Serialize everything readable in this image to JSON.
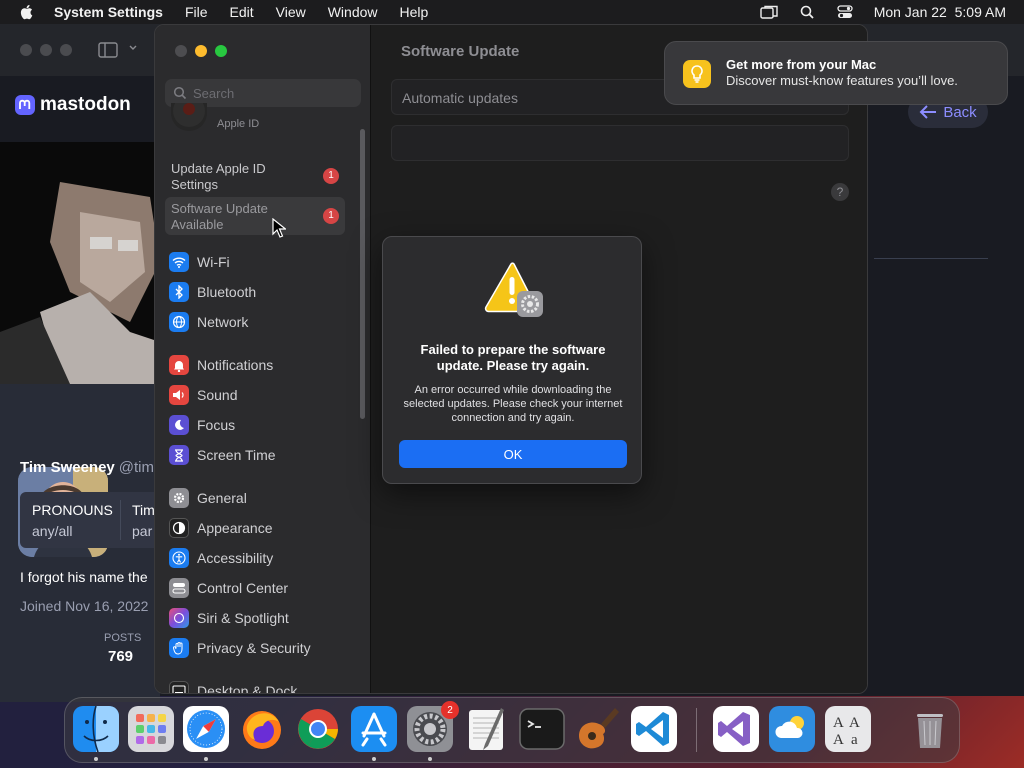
{
  "menubar": {
    "app_name": "System Settings",
    "items": [
      "File",
      "Edit",
      "View",
      "Window",
      "Help"
    ],
    "clock": "Mon Jan 22  5:09 AM"
  },
  "mastodon": {
    "logo_text": "mastodon",
    "profile": {
      "name": "Tim Sweeney",
      "handle": "@tim",
      "field1_label": "PRONOUNS",
      "field1_value": "any/all",
      "field2_label": "Tim",
      "field2_value": "par",
      "bio": "I forgot his name the",
      "joined": "Joined Nov 16, 2022",
      "posts_label": "POSTS",
      "posts_value": "769"
    },
    "back_label": "Back"
  },
  "settings": {
    "search_placeholder": "Search",
    "apple_id_label": "Apple ID",
    "notices": [
      {
        "label": "Update Apple ID Settings",
        "badge": "1"
      },
      {
        "label": "Software Update Available",
        "badge": "1"
      }
    ],
    "sidebar_groups": [
      [
        {
          "label": "Wi-Fi",
          "icon": "wifi-icon",
          "color": "#1b7cf0"
        },
        {
          "label": "Bluetooth",
          "icon": "bluetooth-icon",
          "color": "#1b7cf0"
        },
        {
          "label": "Network",
          "icon": "globe-icon",
          "color": "#1b7cf0"
        }
      ],
      [
        {
          "label": "Notifications",
          "icon": "bell-icon",
          "color": "#e5463f"
        },
        {
          "label": "Sound",
          "icon": "speaker-icon",
          "color": "#e5463f"
        },
        {
          "label": "Focus",
          "icon": "moon-icon",
          "color": "#5b4fd3"
        },
        {
          "label": "Screen Time",
          "icon": "hourglass-icon",
          "color": "#5b4fd3"
        }
      ],
      [
        {
          "label": "General",
          "icon": "gear-icon",
          "color": "#8e8e93"
        },
        {
          "label": "Appearance",
          "icon": "appearance-icon",
          "color": "#222222"
        },
        {
          "label": "Accessibility",
          "icon": "accessibility-icon",
          "color": "#1b7cf0"
        },
        {
          "label": "Control Center",
          "icon": "control-center-icon",
          "color": "#8e8e93"
        },
        {
          "label": "Siri & Spotlight",
          "icon": "siri-icon",
          "color": "#c04bd6"
        },
        {
          "label": "Privacy & Security",
          "icon": "hand-icon",
          "color": "#1b7cf0"
        }
      ],
      [
        {
          "label": "Desktop & Dock",
          "icon": "desktop-icon",
          "color": "#222222"
        }
      ]
    ],
    "content": {
      "title": "Software Update",
      "automatic_updates": "Automatic updates",
      "help": "?"
    }
  },
  "notification": {
    "title": "Get more from your Mac",
    "body": "Discover must-know features you’ll love."
  },
  "alert": {
    "title": "Failed to prepare the software update. Please try again.",
    "body": "An error occurred while downloading the selected updates. Please check your internet connection and try again.",
    "ok_label": "OK"
  },
  "dock": {
    "apps": [
      {
        "name": "finder-app",
        "running": true
      },
      {
        "name": "launchpad-app",
        "running": false
      },
      {
        "name": "safari-app",
        "running": true
      },
      {
        "name": "firefox-app",
        "running": false
      },
      {
        "name": "chrome-app",
        "running": false
      },
      {
        "name": "app-store-app",
        "running": true
      },
      {
        "name": "system-settings-app",
        "running": true,
        "badge": "2"
      },
      {
        "name": "textedit-app",
        "running": false
      },
      {
        "name": "terminal-app",
        "running": false
      },
      {
        "name": "garageband-app",
        "running": false
      },
      {
        "name": "vscode-app",
        "running": false
      },
      {
        "name": "visual-studio-app",
        "running": false
      },
      {
        "name": "weather-app",
        "running": false
      },
      {
        "name": "font-book-app",
        "running": false
      },
      {
        "name": "trash-app",
        "running": false
      }
    ]
  }
}
